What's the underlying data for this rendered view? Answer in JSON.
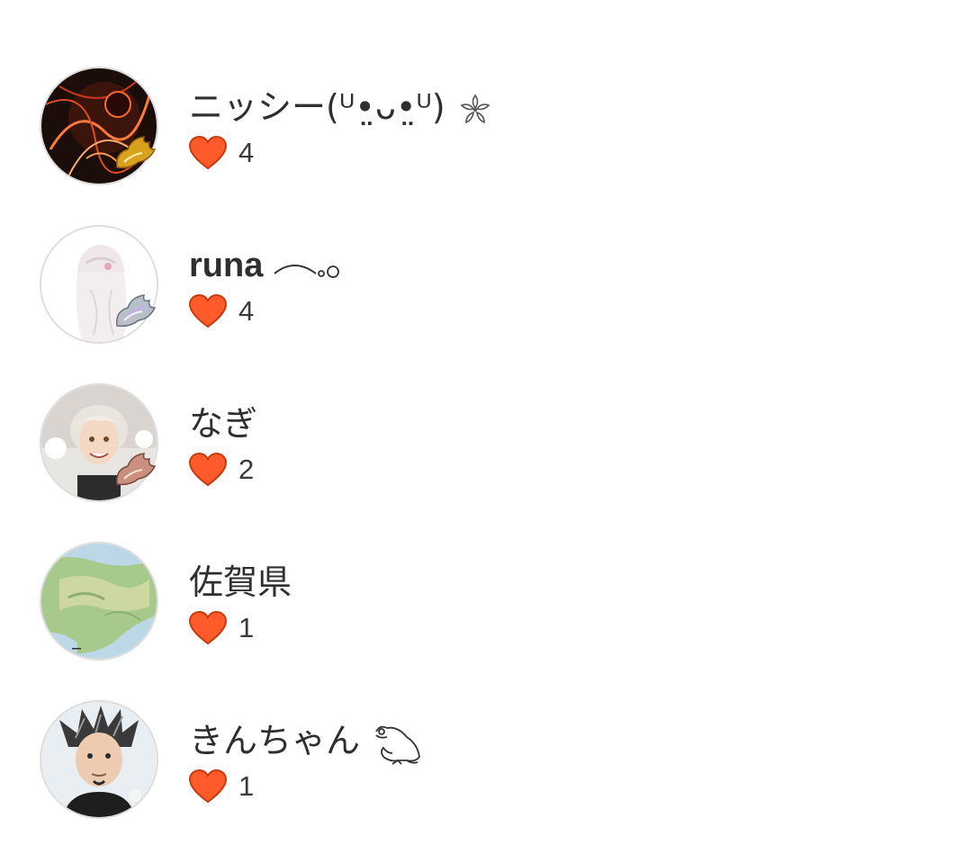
{
  "users": [
    {
      "name": "ニッシー(ᵁ•̤ᴗ•̤ᵁ)",
      "likes": "4",
      "avatar": "fire-art-avatar",
      "badge": "gold-wing-badge",
      "trailing_icon": "sakura-flower-icon"
    },
    {
      "name": "runa",
      "likes": "4",
      "avatar": "anime-girl-avatar",
      "badge": "silver-wing-badge",
      "trailing_icon": "thought-bubble-icon"
    },
    {
      "name": "なぎ",
      "likes": "2",
      "avatar": "anime-boy-avatar",
      "badge": "rose-gold-wing-badge"
    },
    {
      "name": "佐賀県",
      "likes": "1",
      "avatar": "map-avatar"
    },
    {
      "name": "きんちゃん",
      "likes": "1",
      "avatar": "portrait-avatar",
      "trailing_icon": "frog-icon"
    }
  ],
  "heart_icon": "heart-icon",
  "colors": {
    "heart": "#ff5a2a",
    "heart_edge": "#c63a10",
    "text": "#2f2f2f",
    "avatar_border": "#dddddd"
  }
}
